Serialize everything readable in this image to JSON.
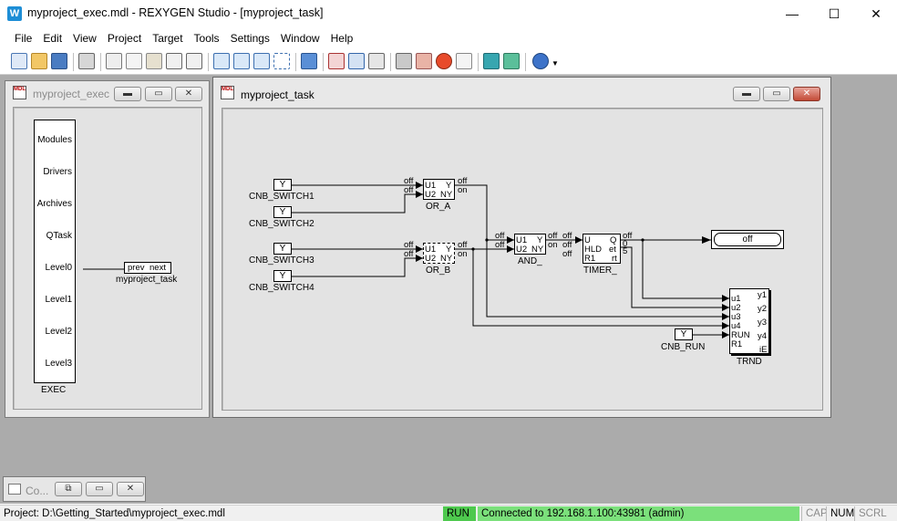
{
  "window": {
    "icon": "W",
    "title": "myproject_exec.mdl - REXYGEN Studio - [myproject_task]",
    "minimize": "—",
    "maximize": "☐",
    "close": "✕"
  },
  "menu": [
    "File",
    "Edit",
    "View",
    "Project",
    "Target",
    "Tools",
    "Settings",
    "Window",
    "Help"
  ],
  "toolbar_icons": [
    "new-icon",
    "open-icon",
    "save-icon",
    "print-icon",
    "cut-icon",
    "copy-icon",
    "paste-icon",
    "undo-icon",
    "redo-icon",
    "zoom-in-icon",
    "zoom-out-icon",
    "zoom-fit-icon",
    "select-icon",
    "compile-icon",
    "download-icon",
    "upload-icon",
    "watch-icon",
    "target-icon",
    "block-icon",
    "refresh-icon",
    "list-icon",
    "diag-icon",
    "trend-icon",
    "info-icon"
  ],
  "exec_window": {
    "title": "myproject_exec",
    "block_name": "EXEC",
    "ports": [
      "Modules",
      "Drivers",
      "Archives",
      "QTask",
      "Level0",
      "Level1",
      "Level2",
      "Level3"
    ],
    "task_block": {
      "in": "prev",
      "out": "next",
      "name": "myproject_task"
    }
  },
  "task_window": {
    "title": "myproject_task",
    "switches": [
      {
        "value": "Y",
        "name": "CNB_SWITCH1"
      },
      {
        "value": "Y",
        "name": "CNB_SWITCH2"
      },
      {
        "value": "Y",
        "name": "CNB_SWITCH3"
      },
      {
        "value": "Y",
        "name": "CNB_SWITCH4"
      },
      {
        "value": "Y",
        "name": "CNB_RUN"
      }
    ],
    "or_a": {
      "name": "OR_A",
      "in1": "U1",
      "in2": "U2",
      "out1": "Y",
      "out2": "NY",
      "lbl_in1": "off",
      "lbl_in2": "off",
      "lbl_out1": "off",
      "lbl_out2": "on"
    },
    "or_b": {
      "name": "OR_B",
      "in1": "U1",
      "in2": "U2",
      "out1": "Y",
      "out2": "NY",
      "lbl_in1": "off",
      "lbl_in2": "off",
      "lbl_out1": "off",
      "lbl_out2": "on"
    },
    "and": {
      "name": "AND_",
      "in1": "U1",
      "in2": "U2",
      "out1": "Y",
      "out2": "NY",
      "lbl_in1": "off",
      "lbl_in2": "off",
      "lbl_out1": "off",
      "lbl_out2": "on"
    },
    "timer": {
      "name": "TIMER_",
      "in1": "U",
      "in2": "HLD",
      "in3": "R1",
      "out1": "Q",
      "out2": "et",
      "out3": "rt",
      "lbl_in1": "off",
      "lbl_in2": "off",
      "lbl_in3": "off",
      "lbl_out1": "off",
      "lbl_out2": "0",
      "lbl_out3": "5"
    },
    "display": {
      "value": "off"
    },
    "trnd": {
      "name": "TRND",
      "inputs": [
        "u1",
        "u2",
        "u3",
        "u4",
        "RUN",
        "R1"
      ],
      "outputs": [
        "y1",
        "y2",
        "y3",
        "y4",
        "iE"
      ]
    }
  },
  "minimized_window": {
    "title": "Co..."
  },
  "status": {
    "project": "Project: D:\\Getting_Started\\myproject_exec.mdl",
    "run": "RUN",
    "connection": "Connected to 192.168.1.100:43981 (admin)",
    "cap": "CAP",
    "num": "NUM",
    "scrl": "SCRL"
  },
  "colors": {
    "run_green": "#4ec94e",
    "connected_green": "#7be07b",
    "mdi_bg": "#ababab"
  }
}
